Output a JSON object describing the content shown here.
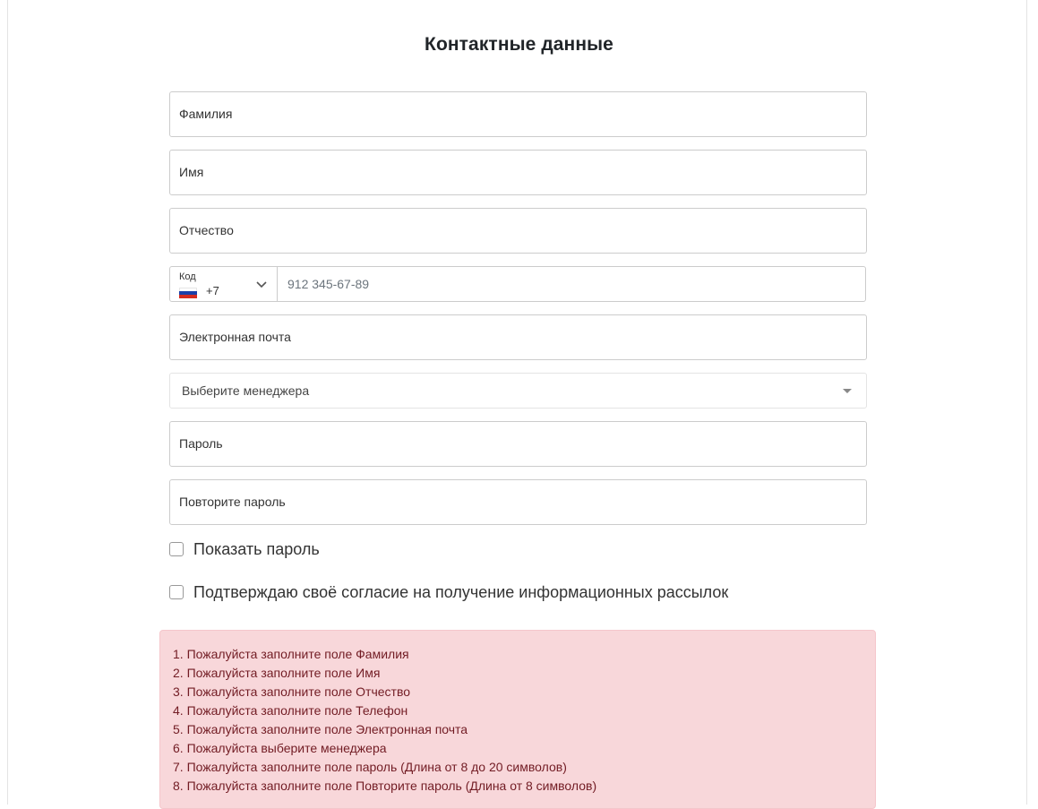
{
  "form": {
    "title": "Контактные данные",
    "last_name_label": "Фамилия",
    "first_name_label": "Имя",
    "middle_name_label": "Отчество",
    "phone": {
      "code_label": "Код",
      "country_flag": "russia-flag",
      "dial_code": "+7",
      "placeholder": "912 345-67-89"
    },
    "email_label": "Электронная почта",
    "manager_select_label": "Выберите менеджера",
    "password_label": "Пароль",
    "repeat_password_label": "Повторите пароль",
    "show_password_label": "Показать пароль",
    "consent_label": "Подтверждаю своё согласие на получение информационных рассылок"
  },
  "errors": [
    "1. Пожалуйста заполните поле Фамилия",
    "2. Пожалуйста заполните поле Имя",
    "3. Пожалуйста заполните поле Отчество",
    "4. Пожалуйста заполните поле Телефон",
    "5. Пожалуйста заполните поле Электронная почта",
    "6. Пожалуйста выберите менеджера",
    "7. Пожалуйста заполните поле пароль (Длина от 8 до 20 символов)",
    "8. Пожалуйста заполните поле Повторите пароль (Длина от 8 символов)"
  ],
  "colors": {
    "alert_background": "#f8d7da",
    "alert_text": "#721c24",
    "field_border": "#cccccc"
  }
}
